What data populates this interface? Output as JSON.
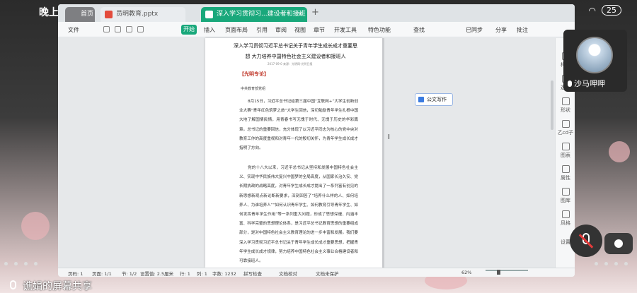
{
  "status_bar": {
    "time": "晚上",
    "battery": "25"
  },
  "tabs": [
    {
      "label": "首页"
    },
    {
      "label": "员明教育.pptx"
    },
    {
      "label": "深入学习贯彻习...建设者和接班人"
    }
  ],
  "ribbon": {
    "file_menu": "文件",
    "start": "开始",
    "items": [
      "插入",
      "页面布局",
      "引用",
      "审阅",
      "视图",
      "章节",
      "开发工具",
      "特色功能"
    ],
    "search": "查找",
    "sync": "已同步",
    "share": "分享",
    "comment": "批注"
  },
  "document": {
    "title": "深入学习贯彻习近平总书记关于青年学生成长成才重要思想 大力培养中国特色社会主义建设者和接班人",
    "meta": "2017-09-0  来源：光明网-光明日报",
    "section": "【光明专论】",
    "byline": "中共教育部党组",
    "paragraphs": [
      "8月15日，习近平总书记给第三届中国“互联网+”大学生创新创业大赛“青年红色筑梦之旅”大学生回信，深切勉励青年学生扎根中国大地了解国情民情，用青春书写无愧于时代、无愧于历史的华彩篇章。总书记的重要回信，充分体现了以习近平同志为核心的党中央对教育工作的高度重视和对青年一代的殷切关怀，为青年学生成长成才指明了方向。",
      "党的十八大以来，习近平总书记从坚持和发展中国特色社会主义、实现中华民族伟大复兴中国梦的全局高度，从国家长治久安、党长期执政的战略高度，对青年学生成长成才提出了一系列富有创见的新思想新观点新论断新要求，深刻回答了“培养什么样的人、如何培养人、为谁培养人”“如何认识青年学生、如何教育引导青年学生、如何发挥青年学生作用”等一系列重大问题，形成了思想深邃、内涵丰富、科学完整的思想理论体系，是习近平总书记教育思想的重要组成部分，是对中国特色社会主义教育理论的进一步丰富和发展。我们要深入学习贯彻习近平总书记关于青年学生成长成才重要思想，把握青年学生成长成才规律，努力培养中国特色社会主义事业合格建设者和可靠接班人。"
    ]
  },
  "float_button": "公文写作",
  "side_panel": [
    "样式",
    "选择",
    "形状",
    "乙cd子",
    "图表",
    "属性",
    "图库",
    "风格",
    "设置"
  ],
  "status_line": {
    "page": "页码: 1",
    "pages": "页面: 1/1",
    "section": "节: 1/2",
    "position": "设置值: 2.5厘米",
    "line": "行: 1",
    "col": "列: 1",
    "words": "字数: 1232",
    "spell": "拼写检查",
    "proof": "文档校对",
    "protect": "文档未保护",
    "zoom": "62%"
  },
  "call": {
    "callee_name": "沙马呷呷",
    "sharer": "谯娟的屏幕共享"
  },
  "colors": {
    "accent": "#19a87b",
    "heading_red": "#c0392b"
  }
}
